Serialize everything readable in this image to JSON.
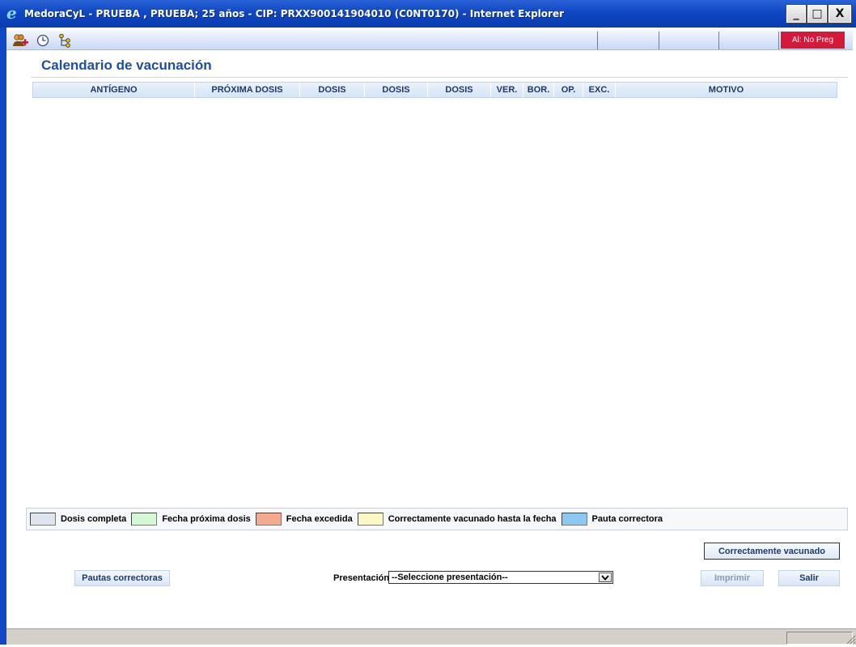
{
  "window": {
    "icon": "internet-explorer-icon",
    "title": "MedoraCyL - PRUEBA , PRUEBA; 25 años - CIP: PRXX900141904010 (C0NT0170) - Internet Explorer",
    "minimize": "_",
    "maximize": "□",
    "close": "X"
  },
  "toolbar": {
    "icons": [
      "add-patient-icon",
      "clock-icon",
      "tree-icon"
    ],
    "alert_badge": "Al: No Preg",
    "alert_color": "#d4193a"
  },
  "page": {
    "title": "Calendario de vacunación"
  },
  "table": {
    "columns": [
      "ANTÍGENO",
      "PRÓXIMA DOSIS",
      "DOSIS",
      "DOSIS",
      "DOSIS",
      "VER.",
      "BOR.",
      "OP.",
      "EXC.",
      "MOTIVO"
    ],
    "rows": []
  },
  "legend": [
    {
      "label": "Dosis completa",
      "color": "#dfe5ee"
    },
    {
      "label": "Fecha próxima dosis",
      "color": "#d4f7d4"
    },
    {
      "label": "Fecha excedida",
      "color": "#f5a98f"
    },
    {
      "label": "Correctamente vacunado hasta la fecha",
      "color": "#fbf8c4"
    },
    {
      "label": "Pauta correctora",
      "color": "#8ec8f0"
    }
  ],
  "buttons": {
    "correctly_vaccinated": "Correctamente vacunado",
    "corrective_schedules": "Pautas correctoras",
    "print": "Imprimir",
    "exit": "Salir"
  },
  "presentation": {
    "label": "Presentación",
    "selected": "--Seleccione presentación--"
  }
}
